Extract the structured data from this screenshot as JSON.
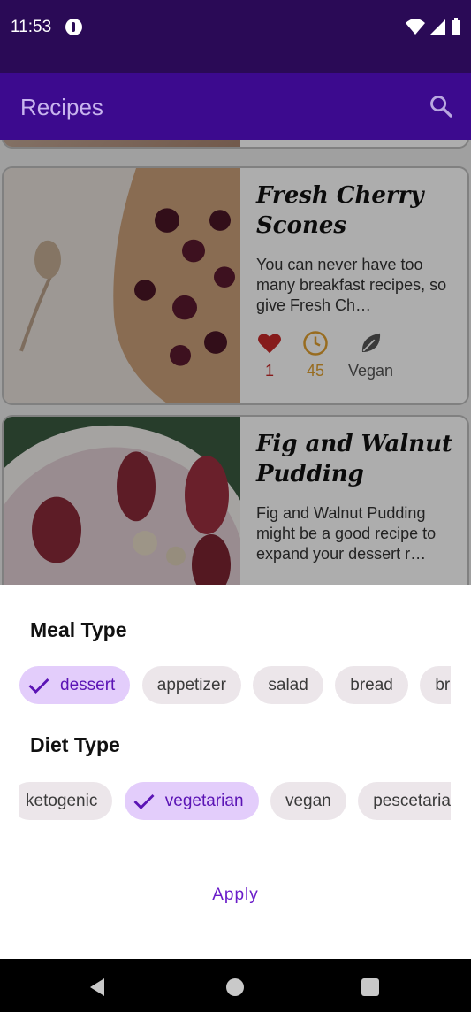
{
  "status": {
    "time": "11:53"
  },
  "appbar": {
    "title": "Recipes"
  },
  "recipes": [
    {
      "title": "Fresh Cherry Scones",
      "description": "You can never have too many breakfast recipes, so give Fresh Ch…",
      "likes": "1",
      "minutes": "45",
      "tag": "Vegan"
    },
    {
      "title": "Fig and Walnut Pudding",
      "description": "Fig and Walnut Pudding might be a good recipe to expand your dessert r…"
    }
  ],
  "sheet": {
    "meal_title": "Meal Type",
    "meal_chips": [
      "dessert",
      "appetizer",
      "salad",
      "bread",
      "breakfast"
    ],
    "diet_title": "Diet Type",
    "diet_chips": [
      "ketogenic",
      "vegetarian",
      "vegan",
      "pescetarian"
    ],
    "apply_label": "Apply"
  },
  "colors": {
    "accent": "#6a1cc9",
    "appbar": "#3c0a8e",
    "statusbar": "#2a0a56",
    "chip_selected": "#e3cdfb"
  }
}
